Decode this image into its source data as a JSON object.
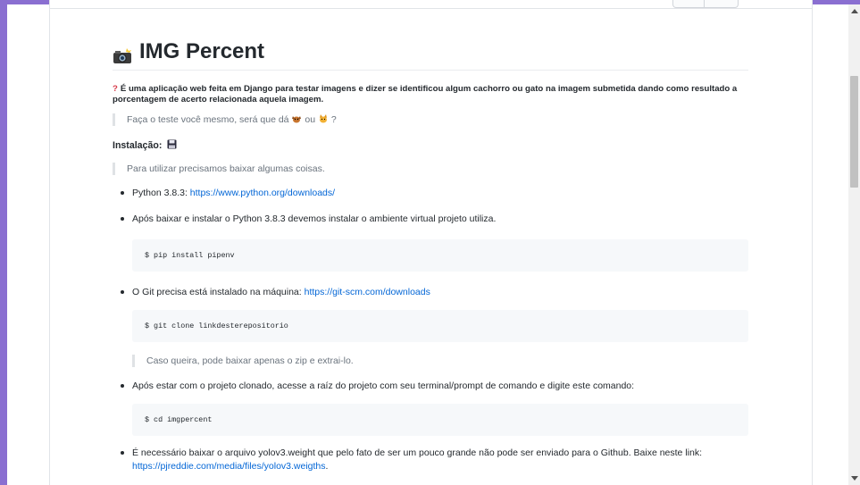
{
  "readme": {
    "title": "IMG Percent",
    "intro": "É uma aplicação web feita em Django para testar imagens e dizer se identificou algum cachorro ou gato na imagem submetida dando como resultado a porcentagem de acerto relacionada aquela imagem.",
    "quote1_before": "Faça o teste você mesmo, será que dá",
    "quote1_middle": "ou",
    "quote1_after": "?",
    "install_title": "Instalação:",
    "quote2": "Para utilizar precisamos baixar algumas coisas.",
    "items": [
      {
        "text": "Python 3.8.3: ",
        "link": "https://www.python.org/downloads/"
      },
      {
        "text": "Após baixar e instalar o Python 3.8.3 devemos instalar o ambiente virtual projeto utiliza."
      },
      {
        "code": "$ pip install pipenv"
      },
      {
        "text": "O Git precisa está instalado na máquina: ",
        "link": "https://git-scm.com/downloads"
      },
      {
        "code": "$ git clone linkdesterepositorio"
      },
      {
        "quote": "Caso queira, pode baixar apenas o zip e extrai-lo."
      },
      {
        "text": "Após estar com o projeto clonado, acesse a raíz do projeto com seu terminal/prompt de comando e digite este comando:"
      },
      {
        "code": "$ cd imgpercent"
      },
      {
        "text": "É necessário baixar o arquivo yolov3.weight que pelo fato de ser um pouco grande não pode ser enviado para o Github. Baixe neste link: ",
        "link": "https://pjreddie.com/media/files/yolov3.weigths",
        "after": "."
      }
    ]
  },
  "icons": {
    "title": "camera-flash-icon",
    "question": "red-question-icon",
    "dog": "dog-icon",
    "cat": "cat-icon",
    "install": "floppy-disk-icon"
  }
}
